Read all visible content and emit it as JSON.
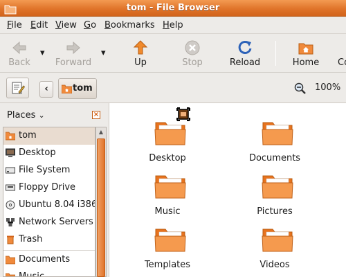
{
  "window": {
    "title": "tom - File Browser"
  },
  "menubar": [
    {
      "label": "File",
      "key": "F",
      "rest": "ile"
    },
    {
      "label": "Edit",
      "key": "E",
      "rest": "dit"
    },
    {
      "label": "View",
      "key": "V",
      "rest": "iew"
    },
    {
      "label": "Go",
      "key": "G",
      "rest": "o"
    },
    {
      "label": "Bookmarks",
      "key": "B",
      "rest": "ookmarks"
    },
    {
      "label": "Help",
      "key": "H",
      "rest": "elp"
    }
  ],
  "toolbar": {
    "back": "Back",
    "forward": "Forward",
    "up": "Up",
    "stop": "Stop",
    "reload": "Reload",
    "home": "Home",
    "computer": "Co"
  },
  "location": {
    "crumb": "tom",
    "zoom": "100%"
  },
  "sidebar": {
    "selector": "Places",
    "items": [
      {
        "label": "tom",
        "icon": "home-folder-icon",
        "selected": true
      },
      {
        "label": "Desktop",
        "icon": "desktop-icon"
      },
      {
        "label": "File System",
        "icon": "harddisk-icon"
      },
      {
        "label": "Floppy Drive",
        "icon": "floppy-icon"
      },
      {
        "label": "Ubuntu 8.04 i386",
        "icon": "cdrom-icon"
      },
      {
        "label": "Network Servers",
        "icon": "network-icon"
      },
      {
        "label": "Trash",
        "icon": "trash-icon"
      },
      {
        "label": "Documents",
        "icon": "folder-icon"
      },
      {
        "label": "Music",
        "icon": "folder-icon"
      }
    ]
  },
  "files": [
    {
      "label": "Desktop"
    },
    {
      "label": "Documents"
    },
    {
      "label": "Music"
    },
    {
      "label": "Pictures"
    },
    {
      "label": "Templates"
    },
    {
      "label": "Videos"
    }
  ],
  "colors": {
    "accent": "#e0742a",
    "folder": "#f08a3c"
  }
}
